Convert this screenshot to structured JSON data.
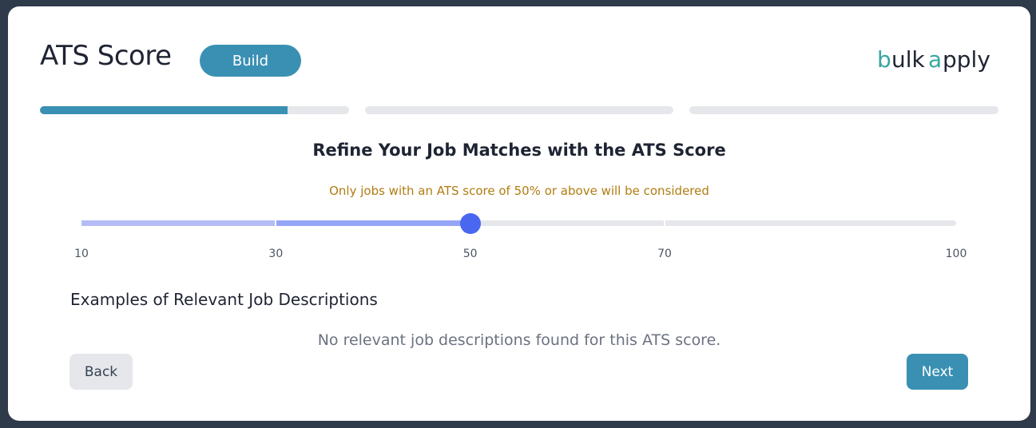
{
  "header": {
    "title": "ATS Score",
    "build_label": "Build",
    "logo": {
      "text": "bulkapply",
      "icon": "bulkapply-logo",
      "colors": {
        "teal": "#3aa6a0",
        "dark": "#1f2433"
      }
    }
  },
  "steps": [
    {
      "progress": 0.8
    },
    {
      "progress": 0
    },
    {
      "progress": 0
    }
  ],
  "main": {
    "heading": "Refine Your Job Matches with the ATS Score",
    "subtitle": "Only jobs with an ATS score of 50% or above will be considered"
  },
  "slider": {
    "min": 10,
    "max": 100,
    "value": 50,
    "ticks": [
      "10",
      "30",
      "50",
      "70",
      "100"
    ]
  },
  "examples": {
    "title": "Examples of Relevant Job Descriptions",
    "empty_text": "No relevant job descriptions found for this ATS score."
  },
  "footer": {
    "back_label": "Back",
    "next_label": "Next"
  },
  "colors": {
    "accent": "#3a90b3",
    "thumb": "#4a67f0",
    "warning_text": "#b07c10"
  }
}
